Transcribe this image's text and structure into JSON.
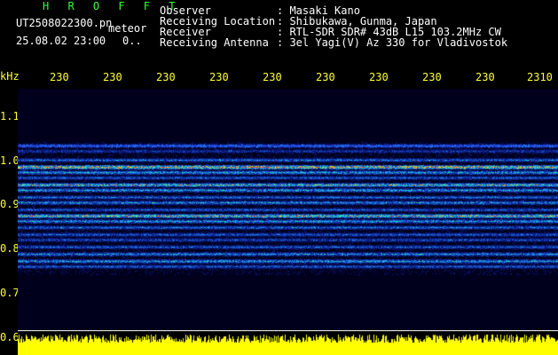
{
  "header": {
    "station_code": "H R O F F T",
    "filename": "UT2508022300.pn",
    "label": "meteor",
    "datetime": "25.08.02 23:00",
    "count": "0..",
    "fields": [
      {
        "label": "Observer",
        "value": ": Masaki Kano"
      },
      {
        "label": "Receiving Location",
        "value": ": Shibukawa, Gunma, Japan"
      },
      {
        "label": "Receiver",
        "value": ": RTL-SDR SDR# 43dB L15 103.2MHz CW"
      },
      {
        "label": "Receiving Antenna",
        "value": ": 3el Yagi(V) Az 330 for Vladivostok"
      }
    ]
  },
  "time_axis": {
    "ticks": [
      "230",
      "230",
      "230",
      "230",
      "230",
      "230",
      "230",
      "230",
      "230",
      "2310"
    ]
  },
  "freq_axis": {
    "unit": "kHz",
    "ticks": [
      "1.1",
      "1.0",
      "0.9",
      "0.8",
      "0.7",
      "0.6"
    ]
  },
  "colors": {
    "text": "#ffffff",
    "axis_labels": "#ffff33",
    "station_code": "#33ff33",
    "background": "#000000",
    "waterfall_bg": "#00001c",
    "spectrum": "#ffff00"
  }
}
